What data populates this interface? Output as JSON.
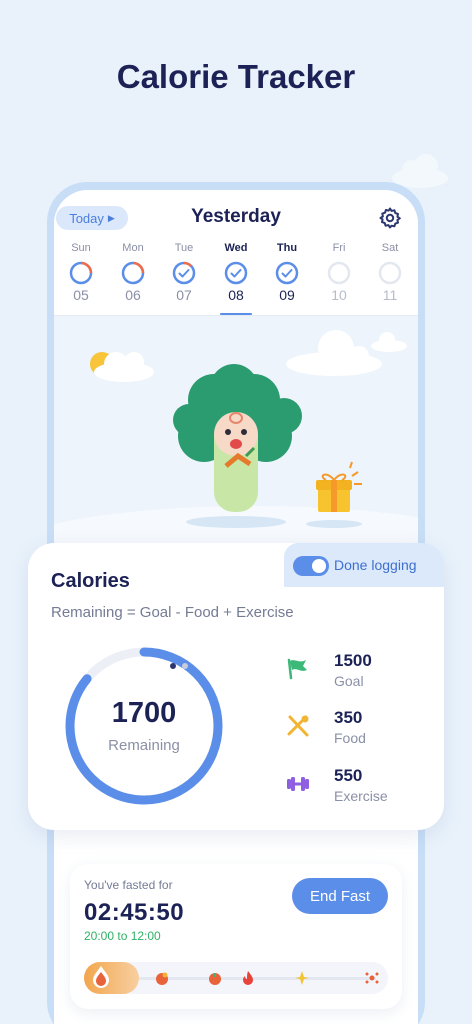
{
  "headline": "Calorie Tracker",
  "header": {
    "today_label": "Today",
    "title": "Yesterday"
  },
  "week": [
    {
      "name": "Sun",
      "num": "05",
      "state": "partial"
    },
    {
      "name": "Mon",
      "num": "06",
      "state": "partial"
    },
    {
      "name": "Tue",
      "num": "07",
      "state": "done"
    },
    {
      "name": "Wed",
      "num": "08",
      "state": "done",
      "selected": true
    },
    {
      "name": "Thu",
      "num": "09",
      "state": "done"
    },
    {
      "name": "Fri",
      "num": "10",
      "state": "future"
    },
    {
      "name": "Sat",
      "num": "11",
      "state": "future"
    }
  ],
  "calories": {
    "done_logging_label": "Done logging",
    "done_logging_on": true,
    "title": "Calories",
    "formula": "Remaining = Goal - Food + Exercise",
    "remaining_value": "1700",
    "remaining_label": "Remaining",
    "remaining_fraction": 0.86,
    "stats": [
      {
        "value": "1500",
        "label": "Goal",
        "icon": "flag-icon",
        "color": "#3cb878"
      },
      {
        "value": "350",
        "label": "Food",
        "icon": "utensils-icon",
        "color": "#f2b533"
      },
      {
        "value": "550",
        "label": "Exercise",
        "icon": "dumbbell-icon",
        "color": "#8e5fe0"
      }
    ]
  },
  "pager": {
    "count": 2,
    "active": 0
  },
  "fasting": {
    "label": "You've fasted for",
    "time": "02:45:50",
    "window": "20:00 to 12:00",
    "end_button": "End Fast",
    "progress_fraction": 0.18
  },
  "colors": {
    "accent": "#5b8ee8",
    "background": "#e9f2fb",
    "text_dark": "#1c2255",
    "green": "#2fb267",
    "orange": "#f2a64e"
  }
}
